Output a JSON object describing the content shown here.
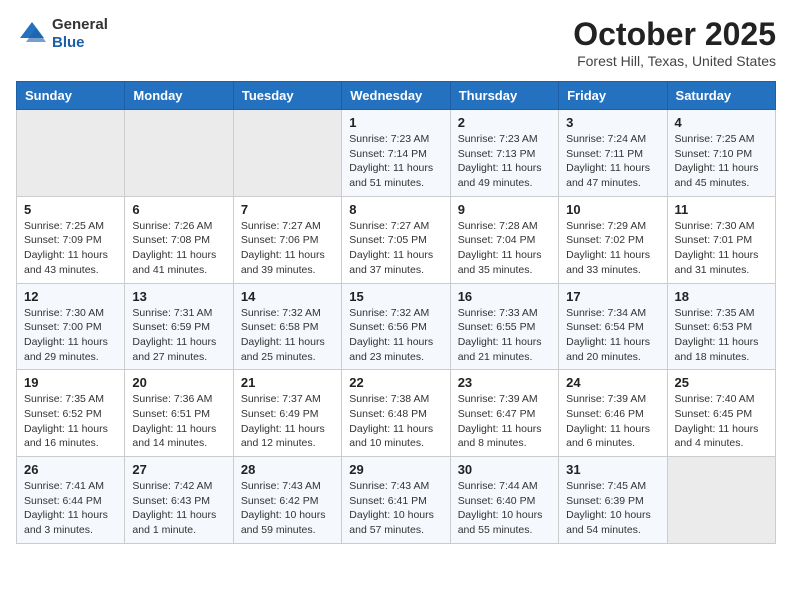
{
  "header": {
    "logo": {
      "general": "General",
      "blue": "Blue"
    },
    "title": "October 2025",
    "location": "Forest Hill, Texas, United States"
  },
  "weekdays": [
    "Sunday",
    "Monday",
    "Tuesday",
    "Wednesday",
    "Thursday",
    "Friday",
    "Saturday"
  ],
  "weeks": [
    [
      {
        "day": "",
        "info": ""
      },
      {
        "day": "",
        "info": ""
      },
      {
        "day": "",
        "info": ""
      },
      {
        "day": "1",
        "info": "Sunrise: 7:23 AM\nSunset: 7:14 PM\nDaylight: 11 hours\nand 51 minutes."
      },
      {
        "day": "2",
        "info": "Sunrise: 7:23 AM\nSunset: 7:13 PM\nDaylight: 11 hours\nand 49 minutes."
      },
      {
        "day": "3",
        "info": "Sunrise: 7:24 AM\nSunset: 7:11 PM\nDaylight: 11 hours\nand 47 minutes."
      },
      {
        "day": "4",
        "info": "Sunrise: 7:25 AM\nSunset: 7:10 PM\nDaylight: 11 hours\nand 45 minutes."
      }
    ],
    [
      {
        "day": "5",
        "info": "Sunrise: 7:25 AM\nSunset: 7:09 PM\nDaylight: 11 hours\nand 43 minutes."
      },
      {
        "day": "6",
        "info": "Sunrise: 7:26 AM\nSunset: 7:08 PM\nDaylight: 11 hours\nand 41 minutes."
      },
      {
        "day": "7",
        "info": "Sunrise: 7:27 AM\nSunset: 7:06 PM\nDaylight: 11 hours\nand 39 minutes."
      },
      {
        "day": "8",
        "info": "Sunrise: 7:27 AM\nSunset: 7:05 PM\nDaylight: 11 hours\nand 37 minutes."
      },
      {
        "day": "9",
        "info": "Sunrise: 7:28 AM\nSunset: 7:04 PM\nDaylight: 11 hours\nand 35 minutes."
      },
      {
        "day": "10",
        "info": "Sunrise: 7:29 AM\nSunset: 7:02 PM\nDaylight: 11 hours\nand 33 minutes."
      },
      {
        "day": "11",
        "info": "Sunrise: 7:30 AM\nSunset: 7:01 PM\nDaylight: 11 hours\nand 31 minutes."
      }
    ],
    [
      {
        "day": "12",
        "info": "Sunrise: 7:30 AM\nSunset: 7:00 PM\nDaylight: 11 hours\nand 29 minutes."
      },
      {
        "day": "13",
        "info": "Sunrise: 7:31 AM\nSunset: 6:59 PM\nDaylight: 11 hours\nand 27 minutes."
      },
      {
        "day": "14",
        "info": "Sunrise: 7:32 AM\nSunset: 6:58 PM\nDaylight: 11 hours\nand 25 minutes."
      },
      {
        "day": "15",
        "info": "Sunrise: 7:32 AM\nSunset: 6:56 PM\nDaylight: 11 hours\nand 23 minutes."
      },
      {
        "day": "16",
        "info": "Sunrise: 7:33 AM\nSunset: 6:55 PM\nDaylight: 11 hours\nand 21 minutes."
      },
      {
        "day": "17",
        "info": "Sunrise: 7:34 AM\nSunset: 6:54 PM\nDaylight: 11 hours\nand 20 minutes."
      },
      {
        "day": "18",
        "info": "Sunrise: 7:35 AM\nSunset: 6:53 PM\nDaylight: 11 hours\nand 18 minutes."
      }
    ],
    [
      {
        "day": "19",
        "info": "Sunrise: 7:35 AM\nSunset: 6:52 PM\nDaylight: 11 hours\nand 16 minutes."
      },
      {
        "day": "20",
        "info": "Sunrise: 7:36 AM\nSunset: 6:51 PM\nDaylight: 11 hours\nand 14 minutes."
      },
      {
        "day": "21",
        "info": "Sunrise: 7:37 AM\nSunset: 6:49 PM\nDaylight: 11 hours\nand 12 minutes."
      },
      {
        "day": "22",
        "info": "Sunrise: 7:38 AM\nSunset: 6:48 PM\nDaylight: 11 hours\nand 10 minutes."
      },
      {
        "day": "23",
        "info": "Sunrise: 7:39 AM\nSunset: 6:47 PM\nDaylight: 11 hours\nand 8 minutes."
      },
      {
        "day": "24",
        "info": "Sunrise: 7:39 AM\nSunset: 6:46 PM\nDaylight: 11 hours\nand 6 minutes."
      },
      {
        "day": "25",
        "info": "Sunrise: 7:40 AM\nSunset: 6:45 PM\nDaylight: 11 hours\nand 4 minutes."
      }
    ],
    [
      {
        "day": "26",
        "info": "Sunrise: 7:41 AM\nSunset: 6:44 PM\nDaylight: 11 hours\nand 3 minutes."
      },
      {
        "day": "27",
        "info": "Sunrise: 7:42 AM\nSunset: 6:43 PM\nDaylight: 11 hours\nand 1 minute."
      },
      {
        "day": "28",
        "info": "Sunrise: 7:43 AM\nSunset: 6:42 PM\nDaylight: 10 hours\nand 59 minutes."
      },
      {
        "day": "29",
        "info": "Sunrise: 7:43 AM\nSunset: 6:41 PM\nDaylight: 10 hours\nand 57 minutes."
      },
      {
        "day": "30",
        "info": "Sunrise: 7:44 AM\nSunset: 6:40 PM\nDaylight: 10 hours\nand 55 minutes."
      },
      {
        "day": "31",
        "info": "Sunrise: 7:45 AM\nSunset: 6:39 PM\nDaylight: 10 hours\nand 54 minutes."
      },
      {
        "day": "",
        "info": ""
      }
    ]
  ]
}
